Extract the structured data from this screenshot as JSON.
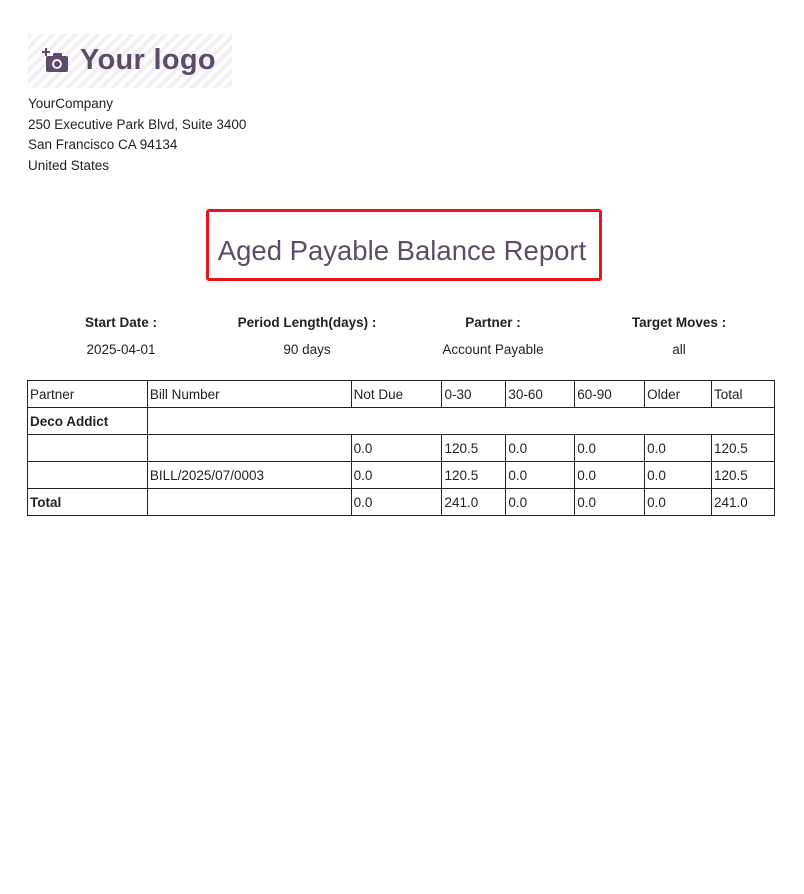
{
  "header": {
    "logo_text": "Your logo",
    "company": {
      "name": "YourCompany",
      "address_line1": "250 Executive Park Blvd, Suite 3400",
      "address_line2": "San Francisco CA 94134",
      "country": "United States"
    }
  },
  "report": {
    "title": "Aged Payable Balance Report",
    "title_highlight_color": "#e8141c",
    "accent_color": "#5e4b69"
  },
  "filters": [
    {
      "label": "Start Date :",
      "value": "2025-04-01"
    },
    {
      "label": "Period Length(days) :",
      "value": "90 days"
    },
    {
      "label": "Partner :",
      "value": "Account Payable"
    },
    {
      "label": "Target Moves :",
      "value": "all"
    }
  ],
  "table": {
    "columns": [
      "Partner",
      "Bill Number",
      "Not Due",
      "0-30",
      "30-60",
      "60-90",
      "Older",
      "Total"
    ],
    "partner_name": "Deco Addict",
    "rows": [
      [
        "",
        "",
        "0.0",
        "120.5",
        "0.0",
        "0.0",
        "0.0",
        "120.5"
      ],
      [
        "",
        "BILL/2025/07/0003",
        "0.0",
        "120.5",
        "0.0",
        "0.0",
        "0.0",
        "120.5"
      ]
    ],
    "total_row": [
      "Total",
      "",
      "0.0",
      "241.0",
      "0.0",
      "0.0",
      "0.0",
      "241.0"
    ]
  }
}
